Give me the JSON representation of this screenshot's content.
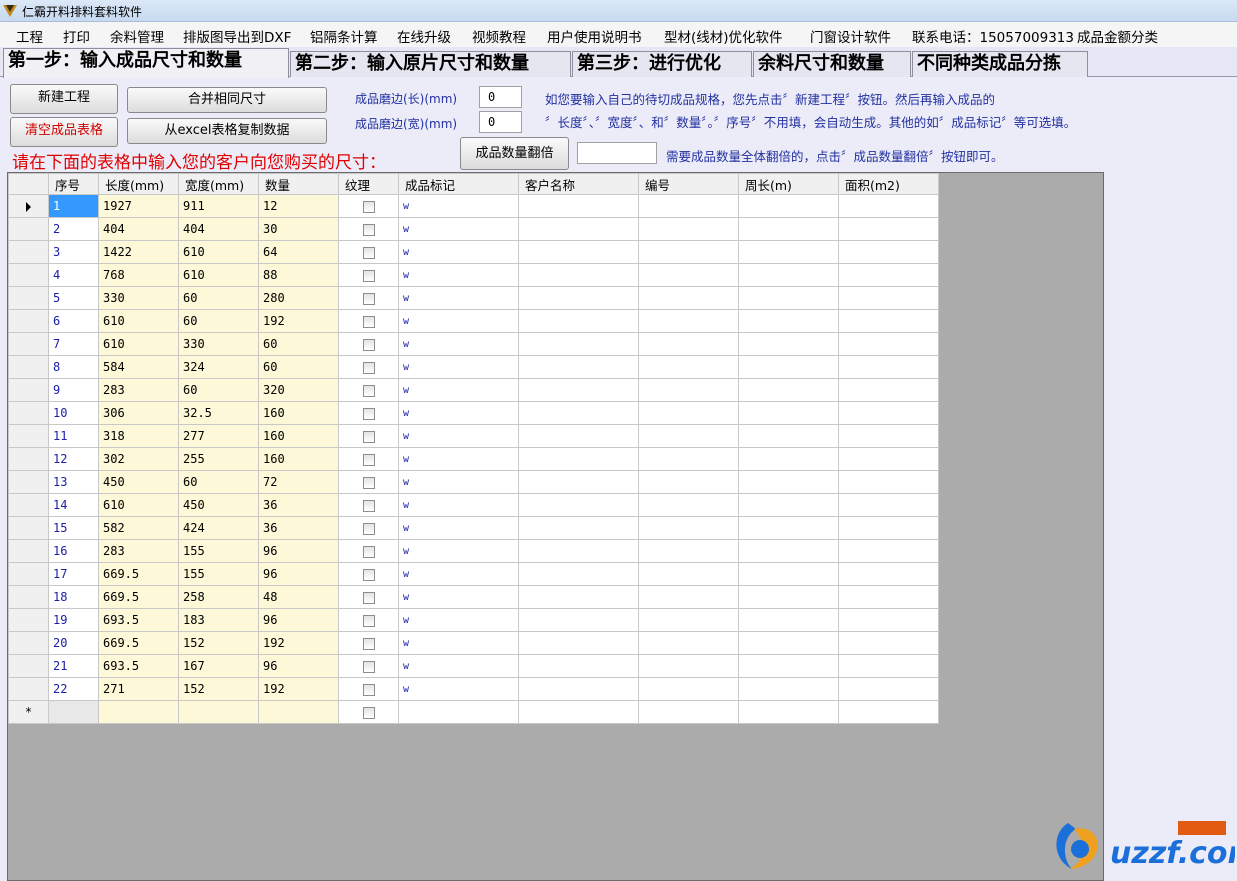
{
  "window": {
    "title": "仁霸开料排料套料软件"
  },
  "menu": [
    "工程",
    "打印",
    "余料管理",
    "排版图导出到DXF",
    "铝隔条计算",
    "在线升级",
    "视频教程",
    "用户使用说明书",
    "型材(线材)优化软件",
    "门窗设计软件",
    "联系电话：15057009313",
    "成品金额分类"
  ],
  "tabs": [
    "第一步：输入成品尺寸和数量",
    "第二步：输入原片尺寸和数量",
    "第三步：进行优化",
    "余料尺寸和数量",
    "不同种类成品分拣"
  ],
  "buttons": {
    "new_project": "新建工程",
    "clear_table": "清空成品表格",
    "merge_same": "合并相同尺寸",
    "copy_excel": "从excel表格复制数据",
    "double_qty": "成品数量翻倍"
  },
  "fields": {
    "edge_length_label": "成品磨边(长)(mm)",
    "edge_length_value": "0",
    "edge_width_label": "成品磨边(宽)(mm)",
    "edge_width_value": "0",
    "double_qty_value": ""
  },
  "hints": {
    "line1": "如您要输入自己的待切成品规格，您先点击〞新建工程〞按钮。然后再输入成品的",
    "line2": "〞长度〞、〞宽度〞、和〞数量〞。〞序号〞不用填，会自动生成。其他的如〞成品标记〞等可选填。",
    "double_hint": "需要成品数量全体翻倍的，点击〞成品数量翻倍〞按钮即可。",
    "enter_sizes": "请在下面的表格中输入您的客户向您购买的尺寸："
  },
  "grid": {
    "columns": [
      "序号",
      "长度(mm)",
      "宽度(mm)",
      "数量",
      "纹理",
      "成品标记",
      "客户名称",
      "编号",
      "周长(m)",
      "面积(m2)"
    ],
    "rows": [
      [
        "1",
        "1927",
        "911",
        "12",
        "w"
      ],
      [
        "2",
        "404",
        "404",
        "30",
        "w"
      ],
      [
        "3",
        "1422",
        "610",
        "64",
        "w"
      ],
      [
        "4",
        "768",
        "610",
        "88",
        "w"
      ],
      [
        "5",
        "330",
        "60",
        "280",
        "w"
      ],
      [
        "6",
        "610",
        "60",
        "192",
        "w"
      ],
      [
        "7",
        "610",
        "330",
        "60",
        "w"
      ],
      [
        "8",
        "584",
        "324",
        "60",
        "w"
      ],
      [
        "9",
        "283",
        "60",
        "320",
        "w"
      ],
      [
        "10",
        "306",
        "32.5",
        "160",
        "w"
      ],
      [
        "11",
        "318",
        "277",
        "160",
        "w"
      ],
      [
        "12",
        "302",
        "255",
        "160",
        "w"
      ],
      [
        "13",
        "450",
        "60",
        "72",
        "w"
      ],
      [
        "14",
        "610",
        "450",
        "36",
        "w"
      ],
      [
        "15",
        "582",
        "424",
        "36",
        "w"
      ],
      [
        "16",
        "283",
        "155",
        "96",
        "w"
      ],
      [
        "17",
        "669.5",
        "155",
        "96",
        "w"
      ],
      [
        "18",
        "669.5",
        "258",
        "48",
        "w"
      ],
      [
        "19",
        "693.5",
        "183",
        "96",
        "w"
      ],
      [
        "20",
        "669.5",
        "152",
        "192",
        "w"
      ],
      [
        "21",
        "693.5",
        "167",
        "96",
        "w"
      ],
      [
        "22",
        "271",
        "152",
        "192",
        "w"
      ]
    ],
    "new_row_marker": "*"
  },
  "icons": {
    "app": "app-logo-icon",
    "current_row": "row-pointer-icon",
    "checkbox": "checkbox-icon"
  },
  "watermark": "uzzf.com",
  "colors": {
    "accent_blue": "#3399ff",
    "label_blue": "#2230a0",
    "warn_red": "#e00000",
    "numeric_blue": "#1c20a8",
    "cell_yellow": "#fdf8d8"
  }
}
